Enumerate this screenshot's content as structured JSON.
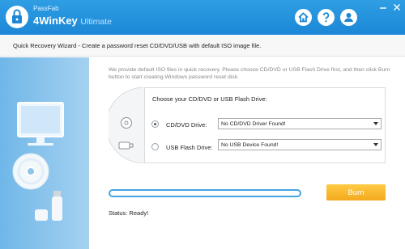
{
  "app": {
    "brand_top": "PassFab",
    "brand_main": "4WinKey",
    "brand_edition": "Ultimate",
    "accent_color": "#1b87d6",
    "header_icons": [
      "home-icon",
      "help-icon",
      "user-icon"
    ],
    "window_icons": [
      "minimize-icon",
      "close-icon"
    ]
  },
  "wizard": {
    "title": "Quick Recovery Wizard - Create a password reset CD/DVD/USB with default ISO image file.",
    "intro": "We provide default ISO files in quick recovery. Please choose CD/DVD or USB Flash Drive first, and then click Burn button to start creating Windows password reset disk.",
    "choose_label": "Choose your CD/DVD or USB Flash Drive:",
    "options": [
      {
        "label": "CD/DVD Drive:",
        "selected": true,
        "value": "No CD/DVD Driver Found!"
      },
      {
        "label": "USB Flash Drive:",
        "selected": false,
        "value": "No USB Device Found!"
      }
    ],
    "progress": 0,
    "burn_label": "Burn",
    "burn_color": "#f3a91d",
    "status": "Status: Ready!"
  }
}
